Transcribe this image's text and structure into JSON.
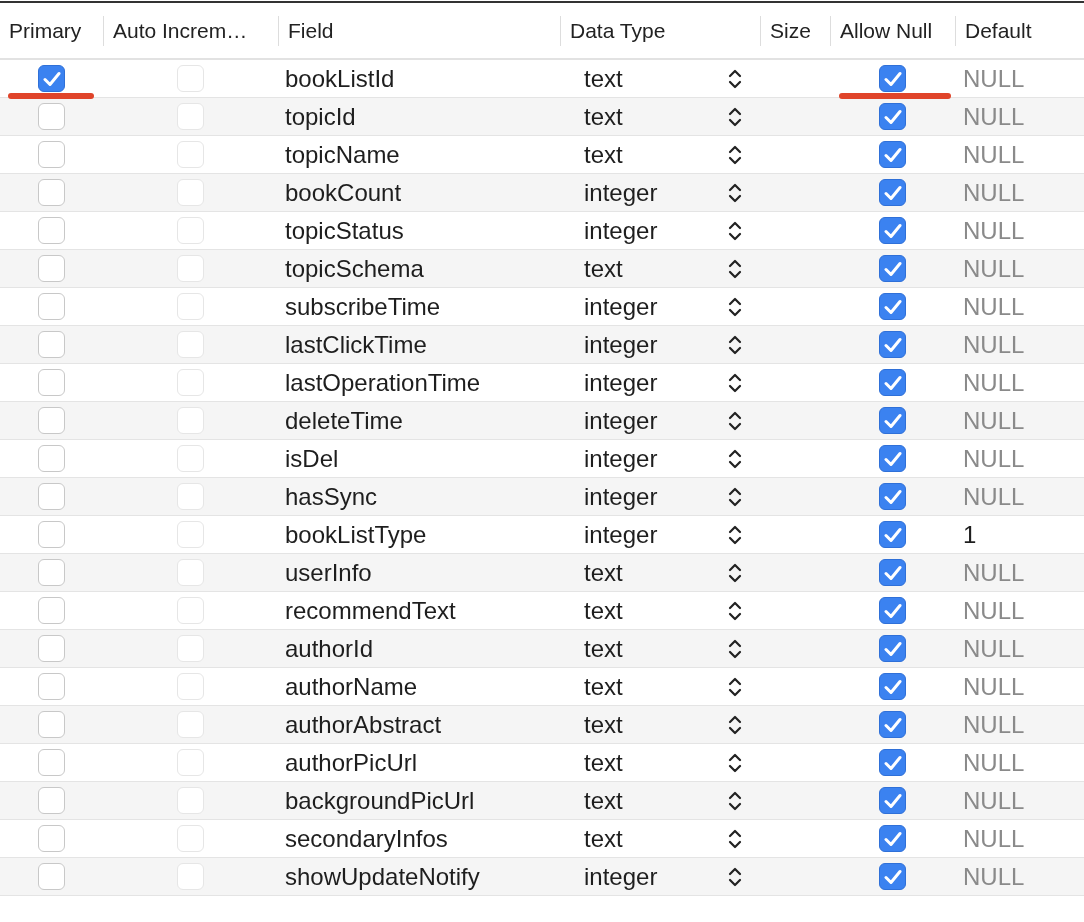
{
  "columns": [
    "Primary",
    "Auto Increm…",
    "Field",
    "Data Type",
    "Size",
    "Allow Null",
    "Default"
  ],
  "rows": [
    {
      "primary": true,
      "auto_increment": false,
      "auto_increment_disabled": true,
      "field": "bookListId",
      "type": "text",
      "allow_null": true,
      "default": "NULL",
      "default_is_null": true,
      "underlined": true
    },
    {
      "primary": false,
      "auto_increment": false,
      "auto_increment_disabled": true,
      "field": "topicId",
      "type": "text",
      "allow_null": true,
      "default": "NULL",
      "default_is_null": true,
      "underlined": false
    },
    {
      "primary": false,
      "auto_increment": false,
      "auto_increment_disabled": true,
      "field": "topicName",
      "type": "text",
      "allow_null": true,
      "default": "NULL",
      "default_is_null": true,
      "underlined": false
    },
    {
      "primary": false,
      "auto_increment": false,
      "auto_increment_disabled": true,
      "field": "bookCount",
      "type": "integer",
      "allow_null": true,
      "default": "NULL",
      "default_is_null": true,
      "underlined": false
    },
    {
      "primary": false,
      "auto_increment": false,
      "auto_increment_disabled": true,
      "field": "topicStatus",
      "type": "integer",
      "allow_null": true,
      "default": "NULL",
      "default_is_null": true,
      "underlined": false
    },
    {
      "primary": false,
      "auto_increment": false,
      "auto_increment_disabled": true,
      "field": "topicSchema",
      "type": "text",
      "allow_null": true,
      "default": "NULL",
      "default_is_null": true,
      "underlined": false
    },
    {
      "primary": false,
      "auto_increment": false,
      "auto_increment_disabled": true,
      "field": "subscribeTime",
      "type": "integer",
      "allow_null": true,
      "default": "NULL",
      "default_is_null": true,
      "underlined": false
    },
    {
      "primary": false,
      "auto_increment": false,
      "auto_increment_disabled": true,
      "field": "lastClickTime",
      "type": "integer",
      "allow_null": true,
      "default": "NULL",
      "default_is_null": true,
      "underlined": false
    },
    {
      "primary": false,
      "auto_increment": false,
      "auto_increment_disabled": true,
      "field": "lastOperationTime",
      "type": "integer",
      "allow_null": true,
      "default": "NULL",
      "default_is_null": true,
      "underlined": false
    },
    {
      "primary": false,
      "auto_increment": false,
      "auto_increment_disabled": true,
      "field": "deleteTime",
      "type": "integer",
      "allow_null": true,
      "default": "NULL",
      "default_is_null": true,
      "underlined": false
    },
    {
      "primary": false,
      "auto_increment": false,
      "auto_increment_disabled": true,
      "field": "isDel",
      "type": "integer",
      "allow_null": true,
      "default": "NULL",
      "default_is_null": true,
      "underlined": false
    },
    {
      "primary": false,
      "auto_increment": false,
      "auto_increment_disabled": true,
      "field": "hasSync",
      "type": "integer",
      "allow_null": true,
      "default": "NULL",
      "default_is_null": true,
      "underlined": false
    },
    {
      "primary": false,
      "auto_increment": false,
      "auto_increment_disabled": true,
      "field": "bookListType",
      "type": "integer",
      "allow_null": true,
      "default": "1",
      "default_is_null": false,
      "underlined": false
    },
    {
      "primary": false,
      "auto_increment": false,
      "auto_increment_disabled": true,
      "field": "userInfo",
      "type": "text",
      "allow_null": true,
      "default": "NULL",
      "default_is_null": true,
      "underlined": false
    },
    {
      "primary": false,
      "auto_increment": false,
      "auto_increment_disabled": true,
      "field": "recommendText",
      "type": "text",
      "allow_null": true,
      "default": "NULL",
      "default_is_null": true,
      "underlined": false
    },
    {
      "primary": false,
      "auto_increment": false,
      "auto_increment_disabled": true,
      "field": "authorId",
      "type": "text",
      "allow_null": true,
      "default": "NULL",
      "default_is_null": true,
      "underlined": false
    },
    {
      "primary": false,
      "auto_increment": false,
      "auto_increment_disabled": true,
      "field": "authorName",
      "type": "text",
      "allow_null": true,
      "default": "NULL",
      "default_is_null": true,
      "underlined": false
    },
    {
      "primary": false,
      "auto_increment": false,
      "auto_increment_disabled": true,
      "field": "authorAbstract",
      "type": "text",
      "allow_null": true,
      "default": "NULL",
      "default_is_null": true,
      "underlined": false
    },
    {
      "primary": false,
      "auto_increment": false,
      "auto_increment_disabled": true,
      "field": "authorPicUrl",
      "type": "text",
      "allow_null": true,
      "default": "NULL",
      "default_is_null": true,
      "underlined": false
    },
    {
      "primary": false,
      "auto_increment": false,
      "auto_increment_disabled": true,
      "field": "backgroundPicUrl",
      "type": "text",
      "allow_null": true,
      "default": "NULL",
      "default_is_null": true,
      "underlined": false
    },
    {
      "primary": false,
      "auto_increment": false,
      "auto_increment_disabled": true,
      "field": "secondaryInfos",
      "type": "text",
      "allow_null": true,
      "default": "NULL",
      "default_is_null": true,
      "underlined": false
    },
    {
      "primary": false,
      "auto_increment": false,
      "auto_increment_disabled": true,
      "field": "showUpdateNotify",
      "type": "integer",
      "allow_null": true,
      "default": "NULL",
      "default_is_null": true,
      "underlined": false
    }
  ]
}
